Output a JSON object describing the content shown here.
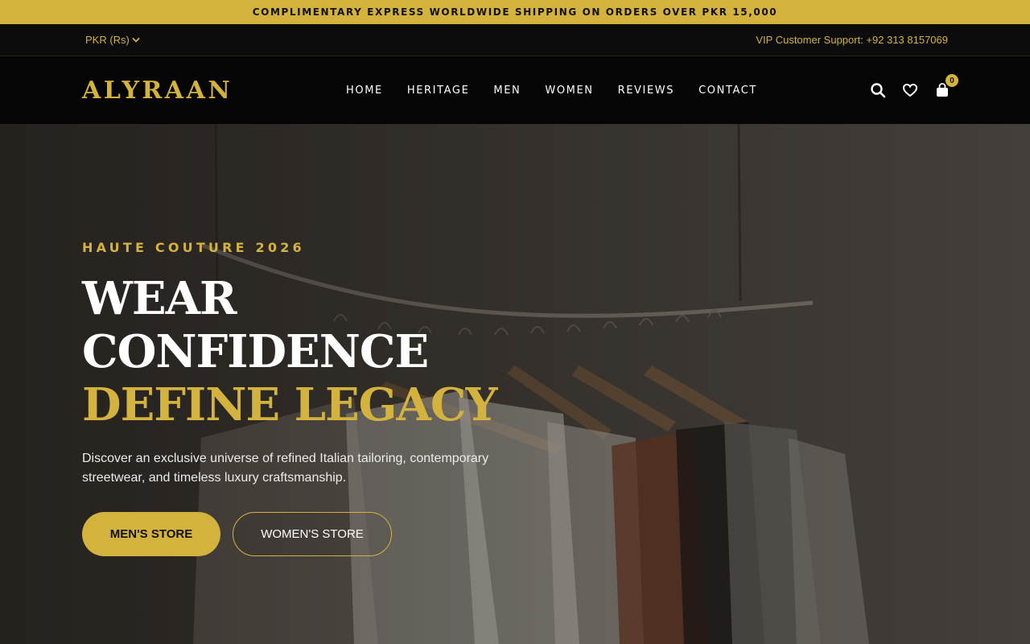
{
  "announcement": "COMPLIMENTARY EXPRESS WORLDWIDE SHIPPING ON ORDERS OVER PKR 15,000",
  "utility": {
    "currency": "PKR (Rs)",
    "support": "VIP Customer Support: +92 313 8157069"
  },
  "nav": {
    "logo": "ALYRAAN",
    "links": [
      "HOME",
      "HERITAGE",
      "MEN",
      "WOMEN",
      "REVIEWS",
      "CONTACT"
    ],
    "cart_count": "0",
    "icons": [
      "search-icon",
      "heart-icon",
      "shopping-bag-icon"
    ]
  },
  "hero": {
    "eyebrow": "HAUTE COUTURE 2026",
    "headline_line1": "WEAR",
    "headline_line2": "CONFIDENCE",
    "headline_line3": "DEFINE LEGACY",
    "lead": "Discover an exclusive universe of refined Italian tailoring, contemporary streetwear, and timeless luxury craftsmanship.",
    "cta_primary": "MEN'S STORE",
    "cta_secondary": "WOMEN'S STORE"
  },
  "colors": {
    "accent": "#d4b23e",
    "nav_background": "#050505",
    "utility_background": "#0c0c0c"
  }
}
